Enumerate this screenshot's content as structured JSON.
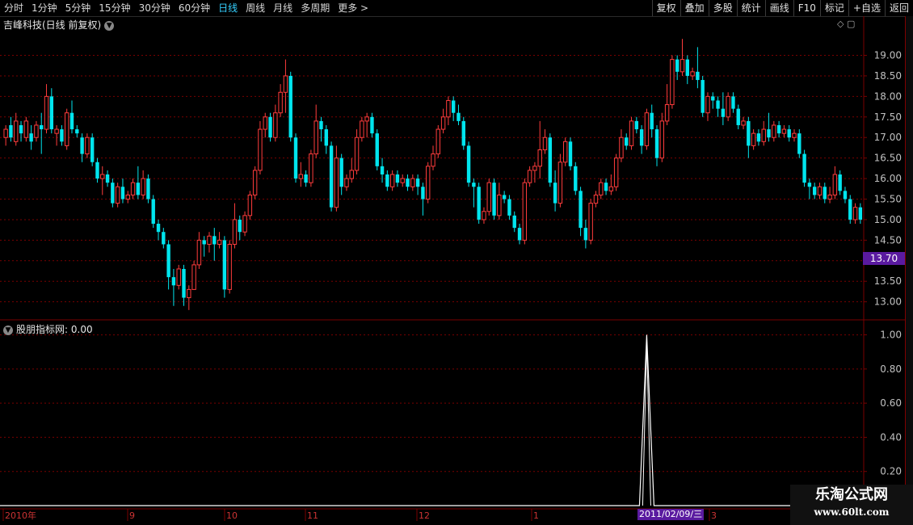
{
  "toolbar": {
    "left": [
      "分时",
      "1分钟",
      "5分钟",
      "15分钟",
      "30分钟",
      "60分钟",
      "日线",
      "周线",
      "月线",
      "多周期",
      "更多 >"
    ],
    "active": "日线",
    "right": [
      "复权",
      "叠加",
      "多股",
      "统计",
      "画线",
      "F10",
      "标记",
      "+自选",
      "返回"
    ]
  },
  "main_chart": {
    "title": "吉峰科技(日线 前复权)",
    "price_tag": "13.70"
  },
  "indicator": {
    "title": "股朋指标网",
    "value": ": 0.00"
  },
  "colors": {
    "up": "#ff3c3c",
    "down": "#00e5ee",
    "grid": "#7a0000",
    "bg": "#000000",
    "tag": "#5a1aa0"
  },
  "x_axis": {
    "labels": [
      "2010年",
      "9",
      "10",
      "11",
      "12",
      "1",
      "3"
    ],
    "crosshair_date": "2011/02/09/三"
  },
  "watermark": {
    "line1": "乐淘公式网",
    "line2": "www.60lt.com"
  },
  "chart_data": [
    {
      "type": "candlestick",
      "title": "吉峰科技(日线 前复权)",
      "ylim": [
        12.6,
        19.6
      ],
      "y_ticks": [
        "19.00",
        "18.50",
        "18.00",
        "17.50",
        "17.00",
        "16.50",
        "16.00",
        "15.50",
        "15.00",
        "14.50",
        "14.00",
        "13.50",
        "13.00"
      ],
      "candles": [
        [
          17.0,
          17.2,
          16.8,
          17.3
        ],
        [
          17.3,
          17.0,
          16.9,
          17.5
        ],
        [
          16.9,
          17.4,
          16.8,
          17.6
        ],
        [
          17.3,
          17.1,
          16.9,
          17.4
        ],
        [
          17.0,
          17.4,
          16.9,
          17.5
        ],
        [
          17.1,
          16.9,
          16.7,
          17.3
        ],
        [
          17.0,
          17.3,
          16.9,
          17.4
        ],
        [
          17.3,
          17.2,
          16.6,
          17.6
        ],
        [
          17.2,
          18.0,
          17.1,
          18.3
        ],
        [
          18.0,
          17.2,
          17.1,
          18.2
        ],
        [
          17.1,
          17.2,
          16.8,
          17.3
        ],
        [
          17.2,
          16.9,
          16.8,
          17.3
        ],
        [
          16.8,
          17.6,
          16.7,
          17.7
        ],
        [
          17.6,
          17.2,
          17.1,
          17.9
        ],
        [
          17.2,
          17.1,
          17.0,
          17.3
        ],
        [
          17.0,
          16.6,
          16.4,
          17.1
        ],
        [
          16.6,
          17.0,
          16.5,
          17.1
        ],
        [
          17.0,
          16.4,
          16.3,
          17.1
        ],
        [
          16.4,
          16.0,
          15.9,
          16.5
        ],
        [
          16.0,
          16.1,
          15.6,
          16.3
        ],
        [
          16.1,
          15.9,
          15.8,
          16.2
        ],
        [
          15.9,
          15.4,
          15.3,
          16.0
        ],
        [
          15.4,
          15.8,
          15.3,
          15.9
        ],
        [
          15.8,
          15.5,
          15.4,
          16.0
        ],
        [
          15.5,
          15.6,
          15.4,
          15.7
        ],
        [
          15.6,
          15.9,
          15.5,
          16.0
        ],
        [
          15.9,
          15.6,
          15.5,
          16.3
        ],
        [
          15.6,
          16.0,
          15.5,
          16.2
        ],
        [
          16.0,
          15.5,
          15.4,
          16.1
        ],
        [
          15.5,
          14.9,
          14.8,
          15.6
        ],
        [
          14.9,
          14.7,
          14.5,
          15.0
        ],
        [
          14.7,
          14.4,
          14.3,
          14.8
        ],
        [
          14.4,
          13.6,
          13.3,
          14.5
        ],
        [
          13.6,
          13.4,
          12.9,
          13.8
        ],
        [
          13.4,
          13.8,
          13.3,
          13.9
        ],
        [
          13.8,
          13.1,
          12.9,
          13.9
        ],
        [
          13.1,
          13.3,
          12.8,
          13.4
        ],
        [
          13.3,
          13.9,
          13.3,
          14.0
        ],
        [
          13.9,
          14.5,
          13.8,
          14.7
        ],
        [
          14.5,
          14.4,
          14.1,
          14.6
        ],
        [
          14.4,
          14.6,
          14.2,
          14.7
        ],
        [
          14.6,
          14.4,
          14.0,
          14.8
        ],
        [
          14.4,
          14.5,
          14.3,
          14.7
        ],
        [
          14.5,
          13.3,
          13.1,
          14.6
        ],
        [
          13.3,
          14.4,
          13.2,
          14.5
        ],
        [
          14.4,
          15.0,
          14.3,
          15.4
        ],
        [
          15.0,
          14.7,
          14.5,
          15.1
        ],
        [
          14.7,
          15.1,
          14.6,
          15.2
        ],
        [
          15.1,
          15.6,
          15.0,
          15.7
        ],
        [
          15.6,
          16.2,
          15.5,
          16.3
        ],
        [
          16.2,
          17.2,
          16.1,
          17.4
        ],
        [
          17.2,
          17.5,
          17.0,
          17.6
        ],
        [
          17.5,
          17.0,
          16.9,
          17.6
        ],
        [
          17.0,
          17.6,
          16.9,
          17.8
        ],
        [
          17.6,
          18.1,
          17.5,
          18.3
        ],
        [
          18.1,
          18.5,
          17.6,
          18.9
        ],
        [
          18.5,
          17.0,
          16.9,
          18.6
        ],
        [
          17.0,
          16.0,
          15.9,
          17.1
        ],
        [
          16.0,
          16.1,
          15.8,
          16.4
        ],
        [
          16.1,
          15.9,
          15.8,
          16.2
        ],
        [
          15.9,
          16.6,
          15.8,
          16.7
        ],
        [
          16.6,
          17.4,
          16.5,
          17.8
        ],
        [
          17.4,
          17.2,
          16.9,
          17.5
        ],
        [
          17.2,
          16.8,
          16.6,
          17.3
        ],
        [
          16.8,
          15.3,
          15.2,
          16.9
        ],
        [
          15.3,
          16.5,
          15.2,
          16.8
        ],
        [
          16.5,
          15.8,
          15.6,
          16.6
        ],
        [
          15.8,
          16.0,
          15.7,
          16.1
        ],
        [
          16.0,
          16.2,
          15.9,
          16.5
        ],
        [
          16.2,
          17.0,
          16.1,
          17.2
        ],
        [
          17.0,
          17.4,
          16.9,
          17.5
        ],
        [
          17.4,
          17.5,
          17.0,
          17.6
        ],
        [
          17.5,
          17.1,
          17.0,
          17.6
        ],
        [
          17.1,
          16.3,
          16.2,
          17.2
        ],
        [
          16.3,
          16.1,
          15.9,
          16.5
        ],
        [
          16.1,
          15.8,
          15.7,
          16.2
        ],
        [
          15.8,
          16.1,
          15.7,
          16.2
        ],
        [
          16.1,
          15.9,
          15.8,
          16.2
        ],
        [
          15.9,
          16.0,
          15.8,
          16.1
        ],
        [
          16.0,
          15.8,
          15.7,
          16.1
        ],
        [
          15.8,
          16.0,
          15.7,
          16.1
        ],
        [
          16.0,
          15.8,
          15.6,
          16.1
        ],
        [
          15.8,
          15.5,
          15.1,
          15.9
        ],
        [
          15.5,
          16.3,
          15.4,
          16.4
        ],
        [
          16.3,
          16.6,
          16.2,
          16.8
        ],
        [
          16.6,
          17.2,
          16.5,
          17.3
        ],
        [
          17.2,
          17.5,
          17.1,
          17.7
        ],
        [
          17.5,
          17.9,
          17.3,
          18.0
        ],
        [
          17.9,
          17.6,
          17.4,
          18.0
        ],
        [
          17.6,
          17.4,
          17.3,
          17.8
        ],
        [
          17.4,
          16.8,
          16.7,
          17.5
        ],
        [
          16.8,
          15.9,
          15.8,
          16.9
        ],
        [
          15.9,
          15.8,
          15.3,
          16.0
        ],
        [
          15.8,
          15.0,
          14.9,
          15.9
        ],
        [
          15.0,
          15.2,
          14.9,
          15.3
        ],
        [
          15.2,
          15.9,
          15.1,
          16.0
        ],
        [
          15.9,
          15.1,
          15.0,
          16.0
        ],
        [
          15.1,
          15.6,
          15.0,
          15.9
        ],
        [
          15.6,
          15.5,
          15.4,
          15.7
        ],
        [
          15.5,
          15.1,
          15.0,
          15.6
        ],
        [
          15.1,
          14.8,
          14.7,
          15.2
        ],
        [
          14.8,
          14.5,
          14.4,
          14.9
        ],
        [
          14.5,
          15.9,
          14.4,
          16.0
        ],
        [
          15.9,
          16.2,
          15.8,
          16.3
        ],
        [
          16.2,
          16.3,
          15.9,
          16.4
        ],
        [
          16.3,
          16.7,
          16.0,
          17.4
        ],
        [
          16.7,
          17.0,
          16.6,
          17.2
        ],
        [
          17.0,
          15.9,
          15.8,
          17.1
        ],
        [
          15.9,
          15.4,
          15.2,
          16.2
        ],
        [
          15.4,
          16.4,
          15.3,
          16.6
        ],
        [
          16.4,
          16.9,
          16.3,
          17.0
        ],
        [
          16.9,
          16.3,
          16.2,
          17.0
        ],
        [
          16.3,
          15.7,
          15.6,
          16.4
        ],
        [
          15.7,
          14.8,
          14.6,
          15.8
        ],
        [
          14.8,
          14.5,
          14.3,
          15.0
        ],
        [
          14.5,
          15.4,
          14.4,
          15.5
        ],
        [
          15.4,
          15.6,
          15.3,
          15.7
        ],
        [
          15.6,
          15.9,
          15.5,
          16.0
        ],
        [
          15.9,
          15.7,
          15.6,
          16.0
        ],
        [
          15.7,
          15.8,
          15.6,
          16.1
        ],
        [
          15.8,
          16.5,
          15.7,
          16.6
        ],
        [
          16.5,
          17.0,
          16.4,
          17.2
        ],
        [
          17.0,
          16.8,
          16.7,
          17.1
        ],
        [
          16.8,
          17.4,
          16.7,
          17.5
        ],
        [
          17.4,
          17.2,
          17.1,
          17.5
        ],
        [
          17.2,
          16.8,
          16.6,
          17.3
        ],
        [
          16.8,
          17.6,
          16.7,
          17.7
        ],
        [
          17.6,
          17.2,
          17.0,
          17.8
        ],
        [
          17.2,
          16.5,
          16.3,
          17.3
        ],
        [
          16.5,
          17.4,
          16.4,
          17.6
        ],
        [
          17.4,
          17.8,
          17.3,
          18.3
        ],
        [
          17.8,
          18.9,
          17.7,
          19.0
        ],
        [
          18.9,
          18.6,
          18.4,
          19.0
        ],
        [
          18.6,
          18.9,
          18.5,
          19.4
        ],
        [
          18.9,
          18.5,
          18.3,
          19.0
        ],
        [
          18.5,
          18.6,
          18.4,
          18.7
        ],
        [
          18.6,
          18.4,
          18.2,
          19.2
        ],
        [
          18.4,
          17.6,
          17.5,
          18.5
        ],
        [
          17.6,
          18.0,
          17.4,
          18.1
        ],
        [
          18.0,
          17.9,
          17.7,
          18.1
        ],
        [
          17.9,
          17.7,
          17.5,
          18.0
        ],
        [
          17.7,
          17.5,
          17.3,
          18.1
        ],
        [
          17.5,
          18.0,
          17.4,
          18.1
        ],
        [
          18.0,
          17.7,
          17.6,
          18.1
        ],
        [
          17.7,
          17.3,
          17.2,
          17.8
        ],
        [
          17.3,
          17.4,
          17.2,
          17.5
        ],
        [
          17.4,
          16.8,
          16.5,
          17.5
        ],
        [
          16.8,
          17.1,
          16.7,
          17.2
        ],
        [
          17.1,
          16.9,
          16.8,
          17.2
        ],
        [
          16.9,
          17.2,
          16.8,
          17.4
        ],
        [
          17.2,
          17.0,
          16.9,
          17.6
        ],
        [
          17.0,
          17.3,
          16.9,
          17.4
        ],
        [
          17.3,
          17.1,
          17.0,
          17.4
        ],
        [
          17.1,
          17.2,
          17.0,
          17.3
        ],
        [
          17.2,
          17.0,
          16.9,
          17.3
        ],
        [
          17.0,
          17.1,
          16.9,
          17.2
        ],
        [
          17.1,
          16.6,
          16.5,
          17.2
        ],
        [
          16.6,
          15.9,
          15.8,
          16.7
        ],
        [
          15.9,
          15.8,
          15.5,
          16.0
        ],
        [
          15.8,
          15.6,
          15.5,
          15.9
        ],
        [
          15.6,
          15.8,
          15.5,
          15.9
        ],
        [
          15.8,
          15.5,
          15.4,
          15.9
        ],
        [
          15.5,
          15.6,
          15.4,
          15.8
        ],
        [
          15.6,
          16.1,
          15.5,
          16.3
        ],
        [
          16.1,
          15.7,
          15.6,
          16.2
        ],
        [
          15.7,
          15.5,
          15.4,
          15.8
        ],
        [
          15.5,
          15.0,
          14.9,
          15.6
        ],
        [
          15.0,
          15.3,
          14.9,
          15.4
        ],
        [
          15.3,
          15.0,
          14.9,
          15.4
        ]
      ]
    },
    {
      "type": "line",
      "title": "股朋指标网",
      "ylim": [
        0,
        1.05
      ],
      "y_ticks": [
        "1.00",
        "0.80",
        "0.60",
        "0.40",
        "0.20"
      ],
      "spike_index": 126,
      "spike_value": 1.0
    }
  ]
}
